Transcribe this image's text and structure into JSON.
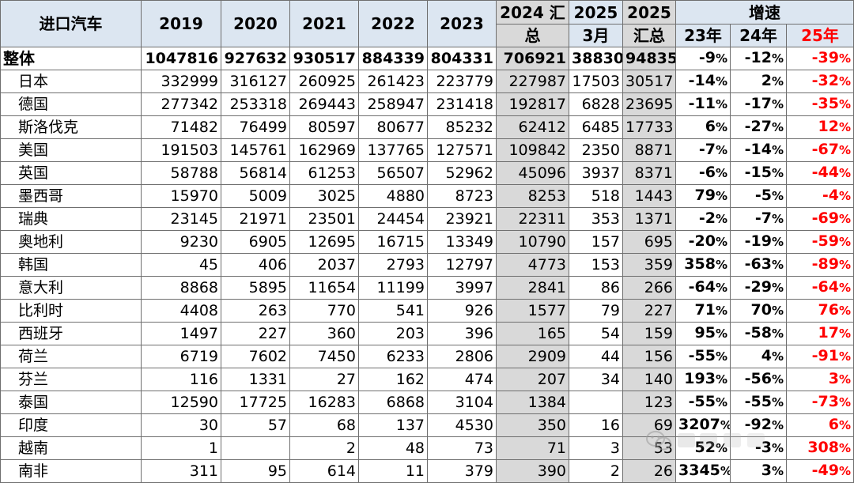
{
  "headers": {
    "country": "进口汽车",
    "y2019": "2019",
    "y2020": "2020",
    "y2021": "2021",
    "y2022": "2022",
    "y2023": "2023",
    "y2024_a": "2024 汇",
    "y2024_b": "总",
    "m2025_a": "2025",
    "m2025_b": "3月",
    "s2025_a": "2025",
    "s2025_b": "汇总",
    "growth": "增速",
    "g23": "23年",
    "g24": "24年",
    "g25": "25年"
  },
  "rows": [
    {
      "name": "整体",
      "v2019": "1047816",
      "v2020": "927632",
      "v2021": "930517",
      "v2022": "884339",
      "v2023": "804331",
      "v2024": "706921",
      "m2025": "38830",
      "s2025": "94835",
      "g23": "-9%",
      "g24": "-12%",
      "g25": "-39%"
    },
    {
      "name": "日本",
      "v2019": "332999",
      "v2020": "316127",
      "v2021": "260925",
      "v2022": "261423",
      "v2023": "223779",
      "v2024": "227987",
      "m2025": "17503",
      "s2025": "30517",
      "g23": "-14%",
      "g24": "2%",
      "g25": "-32%"
    },
    {
      "name": "德国",
      "v2019": "277342",
      "v2020": "253318",
      "v2021": "269443",
      "v2022": "258947",
      "v2023": "231418",
      "v2024": "192817",
      "m2025": "6828",
      "s2025": "23695",
      "g23": "-11%",
      "g24": "-17%",
      "g25": "-35%"
    },
    {
      "name": "斯洛伐克",
      "v2019": "71482",
      "v2020": "76499",
      "v2021": "80597",
      "v2022": "80677",
      "v2023": "85232",
      "v2024": "62412",
      "m2025": "6485",
      "s2025": "17733",
      "g23": "6%",
      "g24": "-27%",
      "g25": "12%"
    },
    {
      "name": "美国",
      "v2019": "191503",
      "v2020": "145761",
      "v2021": "162969",
      "v2022": "137765",
      "v2023": "127571",
      "v2024": "109842",
      "m2025": "2350",
      "s2025": "8871",
      "g23": "-7%",
      "g24": "-14%",
      "g25": "-67%"
    },
    {
      "name": "英国",
      "v2019": "58788",
      "v2020": "56814",
      "v2021": "61253",
      "v2022": "56507",
      "v2023": "52962",
      "v2024": "45096",
      "m2025": "3937",
      "s2025": "8371",
      "g23": "-6%",
      "g24": "-15%",
      "g25": "-44%"
    },
    {
      "name": "墨西哥",
      "v2019": "15970",
      "v2020": "5009",
      "v2021": "3025",
      "v2022": "4880",
      "v2023": "8723",
      "v2024": "8253",
      "m2025": "518",
      "s2025": "1443",
      "g23": "79%",
      "g24": "-5%",
      "g25": "-4%"
    },
    {
      "name": "瑞典",
      "v2019": "23145",
      "v2020": "21971",
      "v2021": "23501",
      "v2022": "24454",
      "v2023": "23921",
      "v2024": "22311",
      "m2025": "353",
      "s2025": "1371",
      "g23": "-2%",
      "g24": "-7%",
      "g25": "-69%"
    },
    {
      "name": "奥地利",
      "v2019": "9230",
      "v2020": "6905",
      "v2021": "12695",
      "v2022": "16715",
      "v2023": "13349",
      "v2024": "10790",
      "m2025": "157",
      "s2025": "695",
      "g23": "-20%",
      "g24": "-19%",
      "g25": "-59%"
    },
    {
      "name": "韩国",
      "v2019": "45",
      "v2020": "406",
      "v2021": "2037",
      "v2022": "2793",
      "v2023": "12797",
      "v2024": "4773",
      "m2025": "153",
      "s2025": "359",
      "g23": "358%",
      "g24": "-63%",
      "g25": "-89%"
    },
    {
      "name": "意大利",
      "v2019": "8868",
      "v2020": "5895",
      "v2021": "11654",
      "v2022": "11199",
      "v2023": "3997",
      "v2024": "2841",
      "m2025": "86",
      "s2025": "266",
      "g23": "-64%",
      "g24": "-29%",
      "g25": "-64%"
    },
    {
      "name": "比利时",
      "v2019": "4408",
      "v2020": "263",
      "v2021": "770",
      "v2022": "541",
      "v2023": "926",
      "v2024": "1577",
      "m2025": "79",
      "s2025": "227",
      "g23": "71%",
      "g24": "70%",
      "g25": "76%"
    },
    {
      "name": "西班牙",
      "v2019": "1497",
      "v2020": "227",
      "v2021": "360",
      "v2022": "203",
      "v2023": "396",
      "v2024": "165",
      "m2025": "54",
      "s2025": "159",
      "g23": "95%",
      "g24": "-58%",
      "g25": "17%"
    },
    {
      "name": "荷兰",
      "v2019": "6719",
      "v2020": "7602",
      "v2021": "7450",
      "v2022": "6233",
      "v2023": "2806",
      "v2024": "2909",
      "m2025": "44",
      "s2025": "156",
      "g23": "-55%",
      "g24": "4%",
      "g25": "-91%"
    },
    {
      "name": "芬兰",
      "v2019": "116",
      "v2020": "1331",
      "v2021": "27",
      "v2022": "162",
      "v2023": "474",
      "v2024": "207",
      "m2025": "34",
      "s2025": "140",
      "g23": "193%",
      "g24": "-56%",
      "g25": "3%"
    },
    {
      "name": "泰国",
      "v2019": "12590",
      "v2020": "17725",
      "v2021": "16283",
      "v2022": "6868",
      "v2023": "3104",
      "v2024": "1384",
      "m2025": "",
      "s2025": "123",
      "g23": "-55%",
      "g24": "-55%",
      "g25": "-73%"
    },
    {
      "name": "印度",
      "v2019": "30",
      "v2020": "57",
      "v2021": "68",
      "v2022": "137",
      "v2023": "4530",
      "v2024": "350",
      "m2025": "16",
      "s2025": "69",
      "g23": "3207%",
      "g24": "-92%",
      "g25": "6%"
    },
    {
      "name": "越南",
      "v2019": "1",
      "v2020": "",
      "v2021": "2",
      "v2022": "48",
      "v2023": "73",
      "v2024": "71",
      "m2025": "3",
      "s2025": "53",
      "g23": "52%",
      "g24": "-3%",
      "g25": "308%"
    },
    {
      "name": "南非",
      "v2019": "311",
      "v2020": "95",
      "v2021": "614",
      "v2022": "11",
      "v2023": "379",
      "v2024": "390",
      "m2025": "2",
      "s2025": "26",
      "g23": "3345%",
      "g24": "3%",
      "g25": "-49%"
    }
  ],
  "colors": {
    "header_bg": "#dce6f1",
    "gray_col": "#d9d9d9",
    "highlight": "#ff0000",
    "border": "#6f6f6f"
  },
  "watermark_icon": "wechat-watermark-icon"
}
